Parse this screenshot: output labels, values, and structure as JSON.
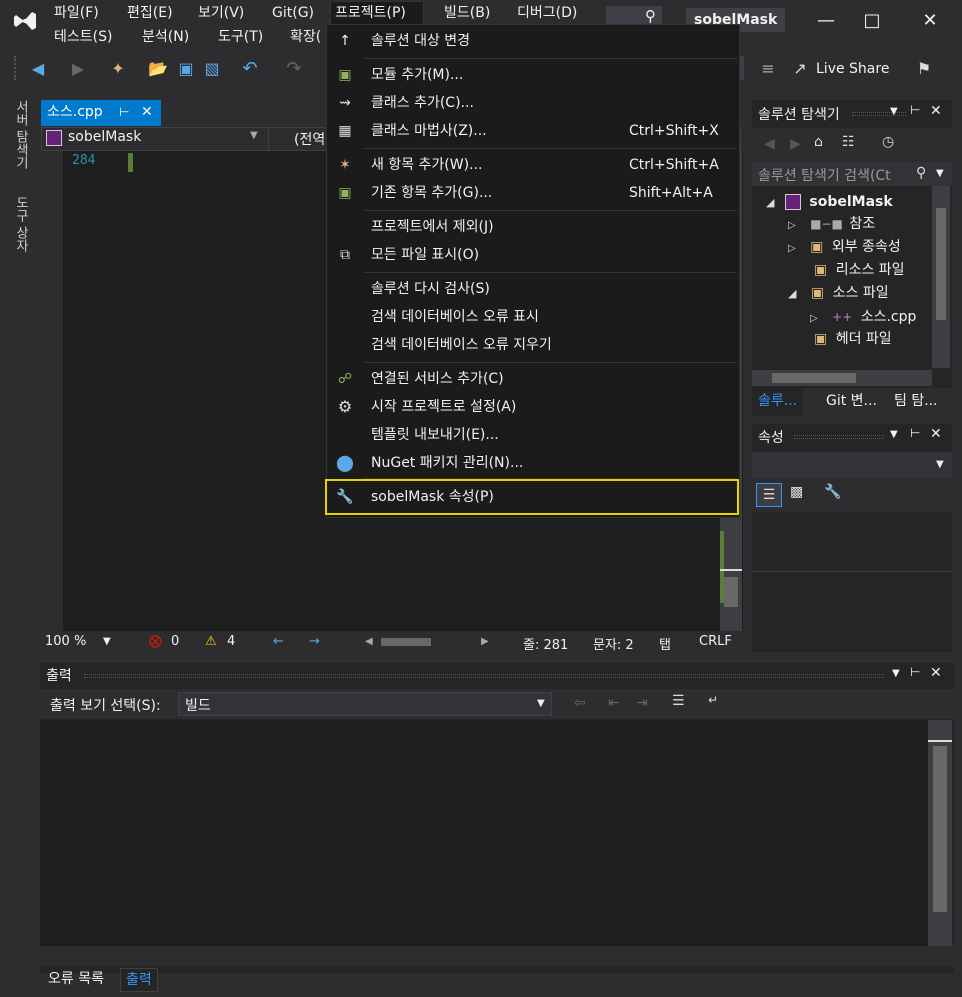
{
  "menu": {
    "items": [
      "파일(F)",
      "편집(E)",
      "보기(V)",
      "Git(G)",
      "프로젝트(P)",
      "빌드(B)",
      "디버그(D)",
      "테스트(S)",
      "분석(N)",
      "도구(T)",
      "확장("
    ],
    "active": "프로젝트(P)"
  },
  "window": {
    "title": "sobelMask"
  },
  "toolbar": {
    "live_share": "Live Share"
  },
  "left_tabs": [
    "서버 탐색기",
    "도구 상자"
  ],
  "editor": {
    "tab_label": "소스.cpp",
    "nav_project": "sobelMask",
    "nav_scope": "(전역",
    "line_number": "284",
    "status": {
      "zoom": "100 %",
      "errors": "0",
      "warnings": "4",
      "line": "줄: 281",
      "col": "문자: 2",
      "tab": "탭",
      "eol": "CRLF"
    }
  },
  "solution_explorer": {
    "title": "솔루션 탐색기",
    "search_placeholder": "솔루션 탐색기 검색(Ct",
    "items": [
      {
        "label": "sobelMask",
        "icon": "project-icon"
      },
      {
        "label": "참조",
        "icon": "references-icon"
      },
      {
        "label": "외부 종속성",
        "icon": "folder-icon"
      },
      {
        "label": "리소스 파일",
        "icon": "folder-icon"
      },
      {
        "label": "소스 파일",
        "icon": "folder-open-icon"
      },
      {
        "label": "소스.cpp",
        "icon": "cpp-file-icon"
      },
      {
        "label": "헤더 파일",
        "icon": "folder-icon"
      }
    ],
    "tabs": [
      "솔루...",
      "Git 변...",
      "팀 탐..."
    ]
  },
  "properties": {
    "title": "속성"
  },
  "output": {
    "title": "출력",
    "source_label": "출력 보기 선택(S):",
    "source_value": "빌드"
  },
  "bottom_tabs": [
    "오류 목록",
    "출력"
  ],
  "project_menu": {
    "items": [
      {
        "label": "솔루션 대상 변경",
        "shortcut": "",
        "icon": "arrow-up-icon"
      },
      {
        "label": "모듈 추가(M)...",
        "shortcut": "",
        "icon": "add-module-icon"
      },
      {
        "label": "클래스 추가(C)...",
        "shortcut": "",
        "icon": "add-class-icon"
      },
      {
        "label": "클래스 마법사(Z)...",
        "shortcut": "Ctrl+Shift+X",
        "icon": "class-wizard-icon"
      },
      {
        "label": "새 항목 추가(W)...",
        "shortcut": "Ctrl+Shift+A",
        "icon": "new-item-icon"
      },
      {
        "label": "기존 항목 추가(G)...",
        "shortcut": "Shift+Alt+A",
        "icon": "existing-item-icon"
      },
      {
        "label": "프로젝트에서 제외(J)",
        "shortcut": "",
        "icon": ""
      },
      {
        "label": "모든 파일 표시(O)",
        "shortcut": "",
        "icon": "show-all-files-icon"
      },
      {
        "label": "솔루션 다시 검사(S)",
        "shortcut": "",
        "icon": ""
      },
      {
        "label": "검색 데이터베이스 오류 표시",
        "shortcut": "",
        "icon": ""
      },
      {
        "label": "검색 데이터베이스 오류 지우기",
        "shortcut": "",
        "icon": ""
      },
      {
        "label": "연결된 서비스 추가(C)",
        "shortcut": "",
        "icon": "connected-service-icon"
      },
      {
        "label": "시작 프로젝트로 설정(A)",
        "shortcut": "",
        "icon": "gear-icon"
      },
      {
        "label": "템플릿 내보내기(E)...",
        "shortcut": "",
        "icon": ""
      },
      {
        "label": "NuGet 패키지 관리(N)...",
        "shortcut": "",
        "icon": "nuget-icon"
      },
      {
        "label": "sobelMask 속성(P)",
        "shortcut": "",
        "icon": "wrench-icon"
      }
    ]
  }
}
